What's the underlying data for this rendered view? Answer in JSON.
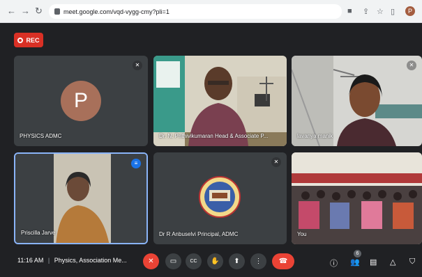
{
  "browser": {
    "url": "meet.google.com/vqd-vygg-cmy?pli=1",
    "profile_initial": "P"
  },
  "meeting": {
    "rec_label": "REC",
    "time": "11:16 AM",
    "separator": "|",
    "title": "Physics, Association Me...",
    "people_count": "6"
  },
  "participants": [
    {
      "name": "PHYSICS ADMC",
      "avatar": "P"
    },
    {
      "name": "Dr. N. Prithivikumaran Head & Associate P..."
    },
    {
      "name": "lavanya manik"
    },
    {
      "name": "Priscilla Jarve"
    },
    {
      "name": "Dr R Anbuselvi Principal, ADMC"
    },
    {
      "name": "You"
    }
  ],
  "colors": {
    "background": "#202124",
    "tile": "#3c4043",
    "rec": "#d93025",
    "end_call": "#ea4335",
    "mic_off": "#ea4335",
    "active_speaker": "#8ab4f8"
  },
  "icons": {
    "tile_mic": "mic-off-icon",
    "speaking": "speaking-icon",
    "controls": [
      "mic-off-icon",
      "camera-icon",
      "captions-icon",
      "raise-hand-icon",
      "present-icon",
      "more-options-icon",
      "end-call-icon"
    ],
    "right_controls": [
      "info-icon",
      "people-icon",
      "chat-icon",
      "activities-icon",
      "host-controls-icon"
    ]
  }
}
